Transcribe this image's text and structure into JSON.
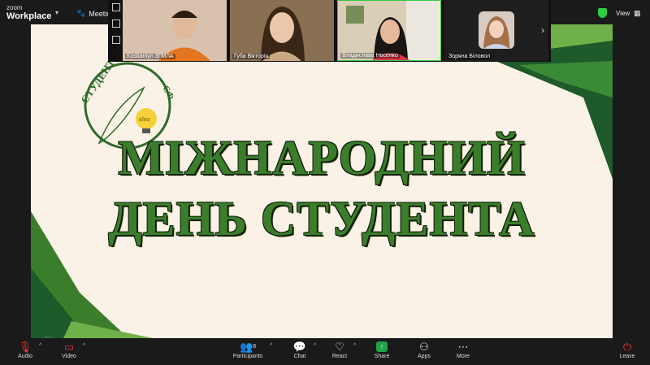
{
  "app": {
    "brand_line1": "zoom",
    "brand_line2": "Workplace",
    "meeting_label": "Meeting",
    "view_label": "View"
  },
  "slide": {
    "logo_text_arc": "СТУДЕНТСЬКА",
    "logo_text_right": "СФ",
    "logo_bulb_text": "idea",
    "headline_line1": "МІЖНАРОДНИЙ",
    "headline_line2": "ДЕНЬ СТУДЕНТА"
  },
  "participants_strip": {
    "tiles": [
      {
        "name": "Kostiantyn ЗГМЛА"
      },
      {
        "name": "Губа Вікторія"
      },
      {
        "name": "Владислава Носенко"
      },
      {
        "name": "Зоряна Біловол"
      }
    ]
  },
  "toolbar": {
    "audio": "Audio",
    "video": "Video",
    "participants": "Participants",
    "participants_count": "8",
    "chat": "Chat",
    "react": "React",
    "share": "Share",
    "apps": "Apps",
    "more": "More",
    "leave": "Leave"
  },
  "colors": {
    "slide_bg": "#fbf2e7",
    "dark_green": "#1f5a2a",
    "mid_green": "#3b7d2a",
    "light_green": "#6fb04a",
    "share_green": "#1fa34a",
    "leave_red": "#e33333"
  }
}
